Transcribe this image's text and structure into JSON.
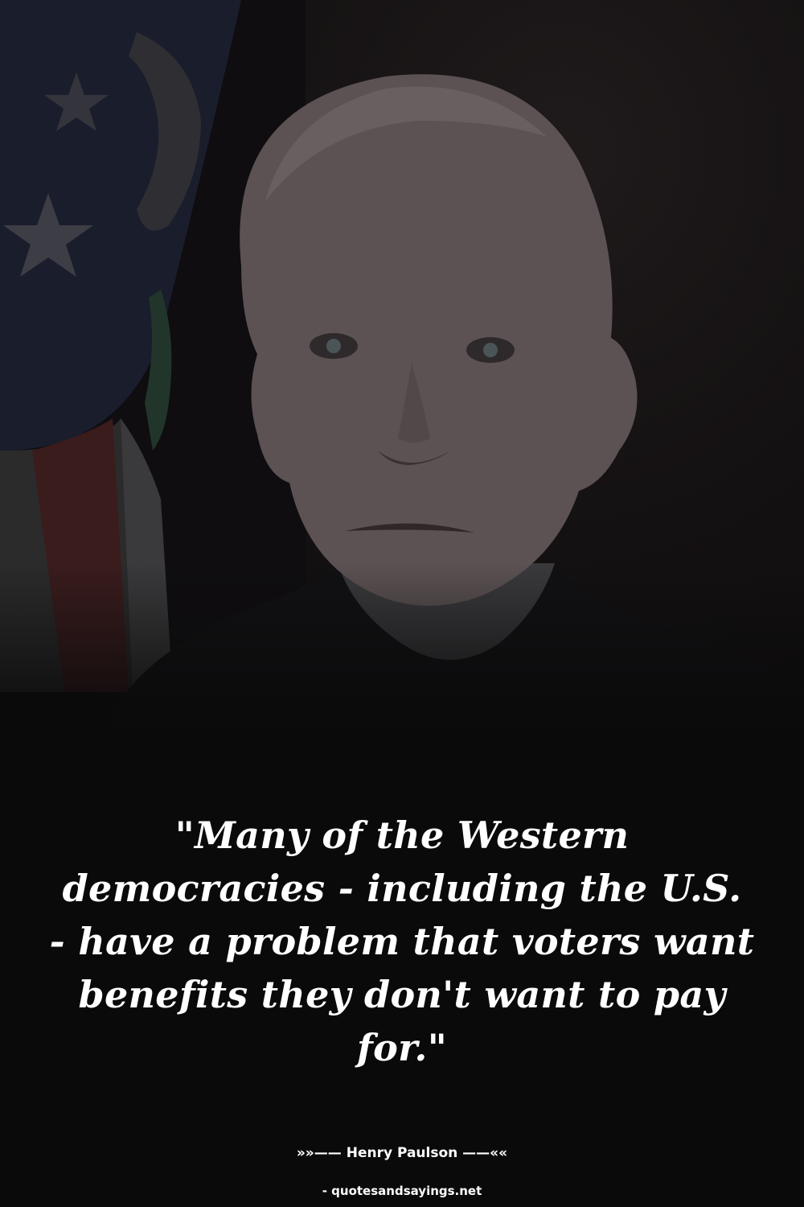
{
  "quote": {
    "text": "\"Many of the Western democracies - including the U.S. - have a problem that voters want benefits they don't want to pay for.\""
  },
  "author": {
    "line": "»»—— Henry Paulson ——««"
  },
  "source": {
    "line": "- quotesandsayings.net"
  },
  "colors": {
    "text": "#ffffff",
    "background": "#0a0a0a"
  }
}
